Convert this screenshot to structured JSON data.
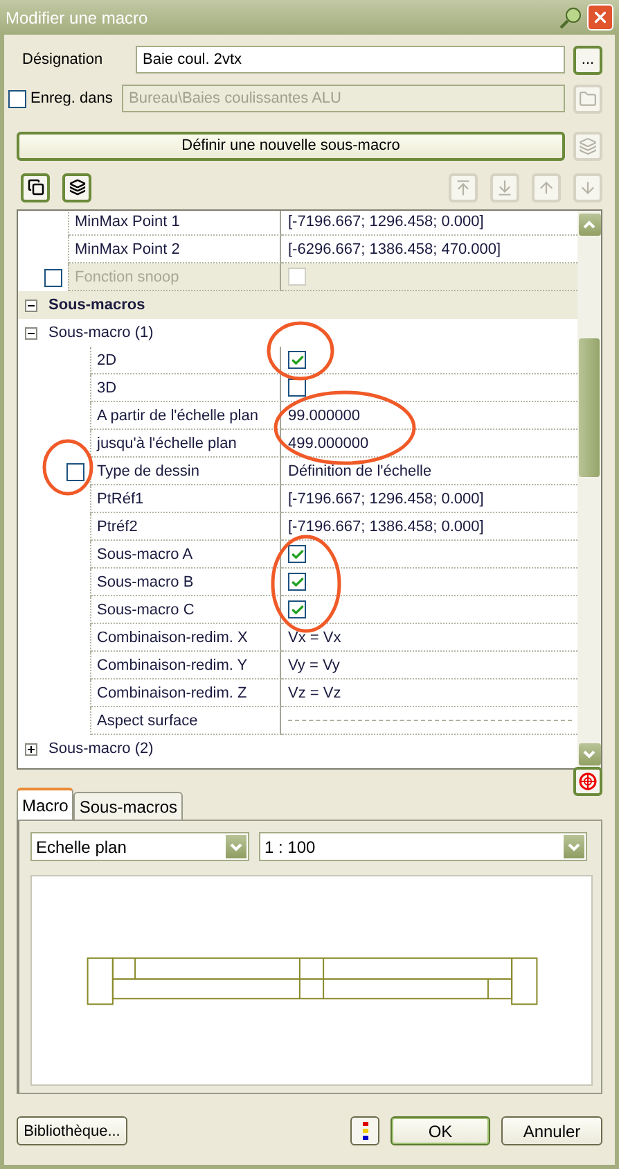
{
  "window": {
    "title": "Modifier une macro"
  },
  "designation": {
    "label": "Désignation",
    "value": "Baie coul. 2vtx",
    "browse": "..."
  },
  "save_in": {
    "label": "Enreg. dans",
    "checked": false,
    "value": "Bureau\\Baies coulissantes ALU",
    "disabled": true
  },
  "define_button": {
    "label": "Définir une nouvelle sous-macro"
  },
  "property_grid": {
    "rows": [
      {
        "kind": "property",
        "name": "MinMax Point 1",
        "cell": {
          "kind": "text",
          "text": "[-7196.667; 1296.458; 0.000]"
        }
      },
      {
        "kind": "property",
        "name": "MinMax Point 2",
        "cell": {
          "kind": "text",
          "text": "[-6296.667; 1386.458; 470.000]"
        }
      },
      {
        "kind": "property",
        "name": "Fonction snoop",
        "disabled": true,
        "row_checkbox": {
          "checked": false
        },
        "cell": {
          "kind": "check",
          "checked": false
        }
      },
      {
        "kind": "category",
        "name": "Sous-macros",
        "expanded": true,
        "children": [
          {
            "kind": "group",
            "name": "Sous-macro (1)",
            "expanded": true,
            "children": [
              {
                "kind": "property",
                "name": "2D",
                "cell": {
                  "kind": "check",
                  "checked": true
                }
              },
              {
                "kind": "property",
                "name": "3D",
                "cell": {
                  "kind": "check",
                  "checked": false
                }
              },
              {
                "kind": "property",
                "name": "A partir de l'échelle plan",
                "cell": {
                  "kind": "text",
                  "text": "99.000000"
                }
              },
              {
                "kind": "property",
                "name": "jusqu'à l'échelle plan",
                "cell": {
                  "kind": "text",
                  "text": "499.000000"
                }
              },
              {
                "kind": "property",
                "name": "Type de dessin",
                "row_checkbox": {
                  "checked": false
                },
                "cell": {
                  "kind": "text",
                  "text": "Définition de l'échelle"
                }
              },
              {
                "kind": "property",
                "name": "PtRéf1",
                "cell": {
                  "kind": "text",
                  "text": "[-7196.667; 1296.458; 0.000]"
                }
              },
              {
                "kind": "property",
                "name": "Ptréf2",
                "cell": {
                  "kind": "text",
                  "text": "[-7196.667; 1386.458; 0.000]"
                }
              },
              {
                "kind": "property",
                "name": "Sous-macro A",
                "cell": {
                  "kind": "check",
                  "checked": true
                }
              },
              {
                "kind": "property",
                "name": "Sous-macro B",
                "cell": {
                  "kind": "check",
                  "checked": true
                }
              },
              {
                "kind": "property",
                "name": "Sous-macro C",
                "cell": {
                  "kind": "check",
                  "checked": true
                }
              },
              {
                "kind": "property",
                "name": "Combinaison-redim. X",
                "cell": {
                  "kind": "text",
                  "text": "Vx = Vx"
                }
              },
              {
                "kind": "property",
                "name": "Combinaison-redim. Y",
                "cell": {
                  "kind": "text",
                  "text": "Vy = Vy"
                }
              },
              {
                "kind": "property",
                "name": "Combinaison-redim. Z",
                "cell": {
                  "kind": "text",
                  "text": "Vz = Vz"
                }
              },
              {
                "kind": "property",
                "name": "Aspect surface",
                "cell": {
                  "kind": "dashed"
                }
              }
            ]
          },
          {
            "kind": "group",
            "name": "Sous-macro (2)",
            "expanded": false
          }
        ]
      }
    ]
  },
  "tabs": [
    {
      "label": "Macro",
      "selected": true
    },
    {
      "label": "Sous-macros",
      "selected": false
    }
  ],
  "scale_type": {
    "value": "Echelle plan"
  },
  "scale": {
    "value": "1 : 100"
  },
  "annotations": [
    {
      "kind": "ellipse"
    },
    {
      "kind": "ellipse"
    },
    {
      "kind": "ellipse"
    },
    {
      "kind": "ellipse"
    }
  ],
  "buttons": {
    "library": "Bibliothèque...",
    "ok": "OK",
    "cancel": "Annuler"
  }
}
